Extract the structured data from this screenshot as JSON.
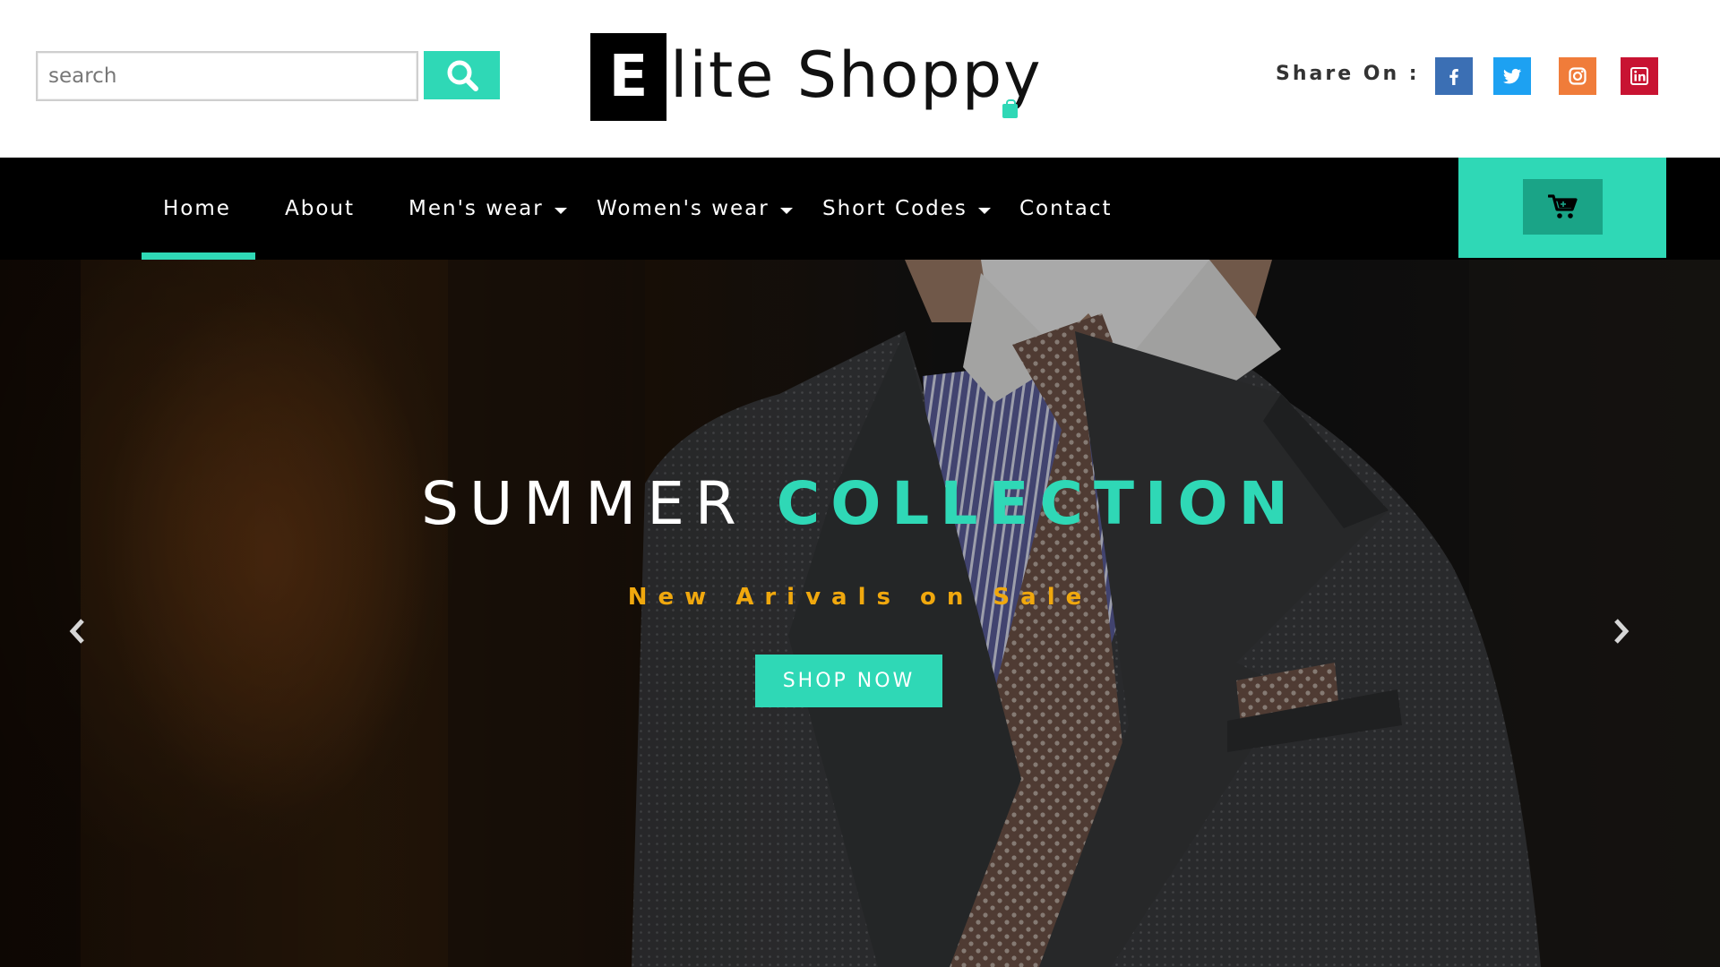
{
  "header": {
    "search": {
      "placeholder": "search",
      "value": ""
    },
    "search_button_icon": "search-icon",
    "logo": {
      "letter": "E",
      "text": "lite Shoppy"
    },
    "share_label": "Share On :",
    "social": [
      {
        "name": "facebook",
        "icon": "facebook-icon",
        "color": "#3b6fb4",
        "glyph": "f"
      },
      {
        "name": "twitter",
        "icon": "twitter-icon",
        "color": "#1da1f2"
      },
      {
        "name": "instagram",
        "icon": "instagram-icon",
        "color": "#f07c3a"
      },
      {
        "name": "linkedin",
        "icon": "linkedin-icon",
        "color": "#c81332",
        "glyph": "in"
      }
    ]
  },
  "nav": {
    "items": [
      {
        "label": "Home",
        "active": true,
        "dropdown": false
      },
      {
        "label": "About",
        "active": false,
        "dropdown": false
      },
      {
        "label": "Men's wear",
        "active": false,
        "dropdown": true
      },
      {
        "label": "Women's wear",
        "active": false,
        "dropdown": true
      },
      {
        "label": "Short Codes",
        "active": false,
        "dropdown": true
      },
      {
        "label": "Contact",
        "active": false,
        "dropdown": false
      }
    ],
    "cart_icon": "cart-icon"
  },
  "hero": {
    "title_part1": "SUMMER",
    "title_part2": "COLLECTION",
    "subtitle": "New Arivals on Sale",
    "cta_label": "SHOP NOW",
    "prev_icon": "chevron-left-icon",
    "next_icon": "chevron-right-icon"
  },
  "colors": {
    "accent": "#2fd8b6",
    "accent_dark": "#1aa487",
    "subtitle": "#f0a80e",
    "nav_bg": "#000000"
  }
}
